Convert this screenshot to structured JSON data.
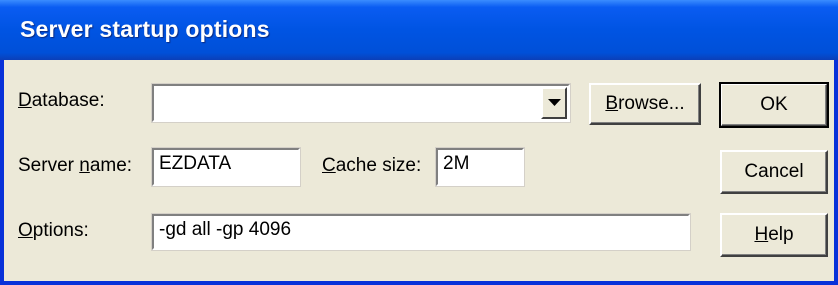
{
  "dialog": {
    "title": "Server startup options"
  },
  "database": {
    "label_prefix": "",
    "label_hotkey": "D",
    "label_rest": "atabase:",
    "value": ""
  },
  "server_name": {
    "label_prefix": "Server ",
    "label_hotkey": "n",
    "label_rest": "ame:",
    "value": "EZDATA"
  },
  "cache_size": {
    "label_prefix": "",
    "label_hotkey": "C",
    "label_rest": "ache size:",
    "value": "2M"
  },
  "options": {
    "label_prefix": "",
    "label_hotkey": "O",
    "label_rest": "ptions:",
    "value": "-gd all -gp 4096"
  },
  "buttons": {
    "browse": {
      "hotkey": "B",
      "rest": "rowse..."
    },
    "ok": {
      "label": "OK"
    },
    "cancel": {
      "label": "Cancel"
    },
    "help": {
      "hotkey": "H",
      "rest": "elp"
    }
  },
  "icons": {
    "dropdown": "chevron-down-icon"
  }
}
